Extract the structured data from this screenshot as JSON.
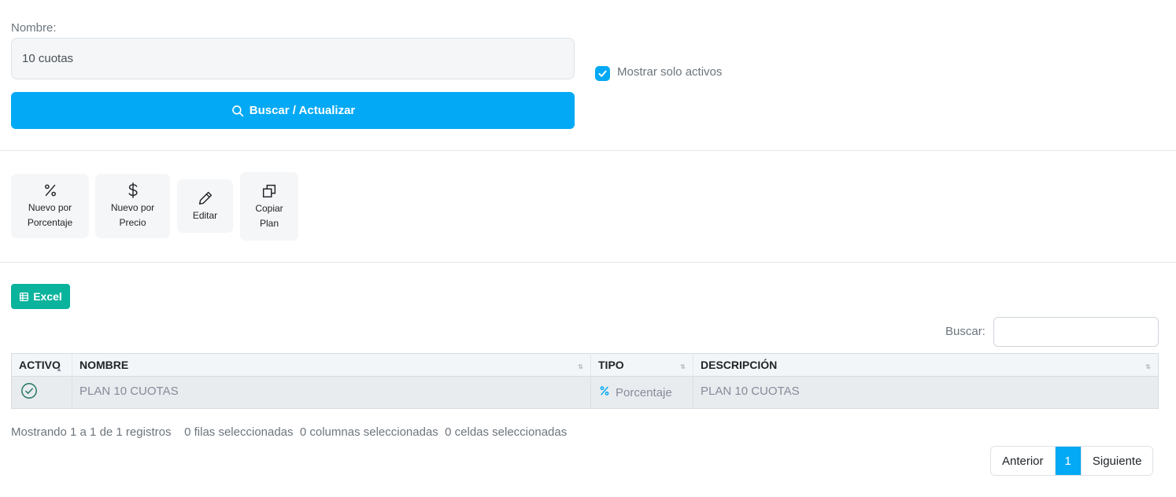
{
  "form": {
    "nombre_label": "Nombre:",
    "nombre_value": "10 cuotas",
    "buscar_label": "Buscar / Actualizar",
    "solo_activos_label": "Mostrar solo activos",
    "solo_activos_checked": true
  },
  "actions": [
    {
      "line1": "Nuevo por",
      "line2": "Porcentaje",
      "icon": "percent-icon"
    },
    {
      "line1": "Nuevo por",
      "line2": "Precio",
      "icon": "dollar-icon"
    },
    {
      "line1": "Editar",
      "line2": "",
      "icon": "pencil-icon"
    },
    {
      "line1": "Copiar",
      "line2": "Plan",
      "icon": "copy-icon"
    }
  ],
  "toolbar": {
    "excel_label": "Excel",
    "buscar_label": "Buscar:"
  },
  "table": {
    "headers": [
      "ACTIVO",
      "NOMBRE",
      "TIPO",
      "DESCRIPCIÓN"
    ],
    "rows": [
      {
        "activo": true,
        "nombre": "PLAN 10 CUOTAS",
        "tipo": "Porcentaje",
        "descripcion": "PLAN 10 CUOTAS"
      }
    ]
  },
  "footer": {
    "info": "Mostrando 1 a 1 de 1 registros    0 filas seleccionadas  0 columnas seleccionadas  0 celdas seleccionadas"
  },
  "pagination": {
    "prev_label": "Anterior",
    "current_page": "1",
    "next_label": "Siguiente"
  },
  "colors": {
    "primary": "#03a9f4",
    "success": "#0ab39c",
    "check_icon": "#2e7d6b"
  }
}
